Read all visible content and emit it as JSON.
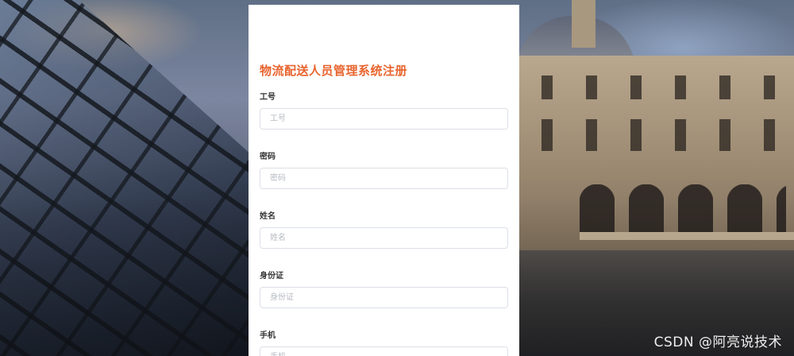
{
  "form": {
    "title": "物流配送人员管理系统注册",
    "fields": [
      {
        "label": "工号",
        "placeholder": "工号",
        "value": ""
      },
      {
        "label": "密码",
        "placeholder": "密码",
        "value": ""
      },
      {
        "label": "姓名",
        "placeholder": "姓名",
        "value": ""
      },
      {
        "label": "身份证",
        "placeholder": "身份证",
        "value": ""
      },
      {
        "label": "手机",
        "placeholder": "手机",
        "value": ""
      }
    ]
  },
  "watermark": "CSDN @阿亮说技术",
  "colors": {
    "title": "#e8642e",
    "card": "#ffffff",
    "input_border": "#dcdfe6"
  }
}
